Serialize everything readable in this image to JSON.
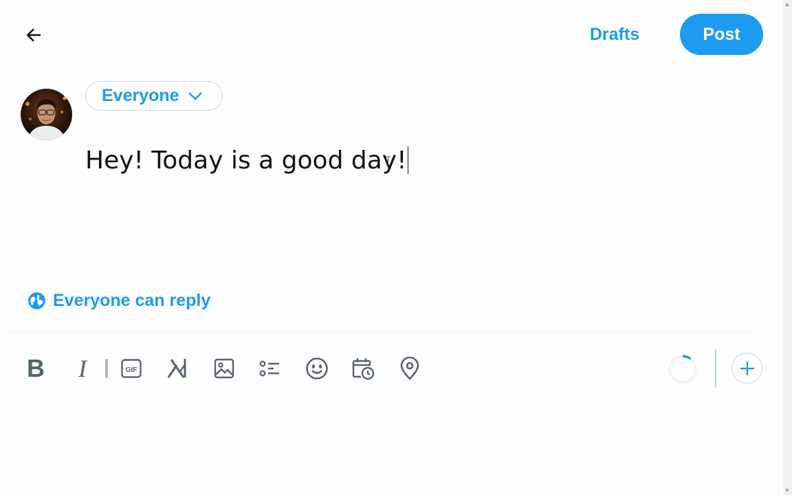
{
  "header": {
    "back_icon": "arrow-left-icon",
    "drafts_label": "Drafts",
    "post_label": "Post"
  },
  "audience": {
    "label": "Everyone",
    "icon": "chevron-down-icon"
  },
  "composer": {
    "text": "Hey! Today is a good day!"
  },
  "reply_setting": {
    "icon": "globe-icon",
    "label": "Everyone can reply"
  },
  "toolbar": {
    "bold_glyph": "B",
    "italic_glyph": "I",
    "items": [
      "bold-icon",
      "italic-icon",
      "gif-icon",
      "grok-icon",
      "image-icon",
      "poll-icon",
      "emoji-icon",
      "schedule-icon",
      "location-icon"
    ],
    "gif_text": "GIF",
    "add_icon": "plus-icon"
  },
  "colors": {
    "accent": "#1d9bf0",
    "icon_gray": "#536471",
    "border": "#cfd9de"
  }
}
